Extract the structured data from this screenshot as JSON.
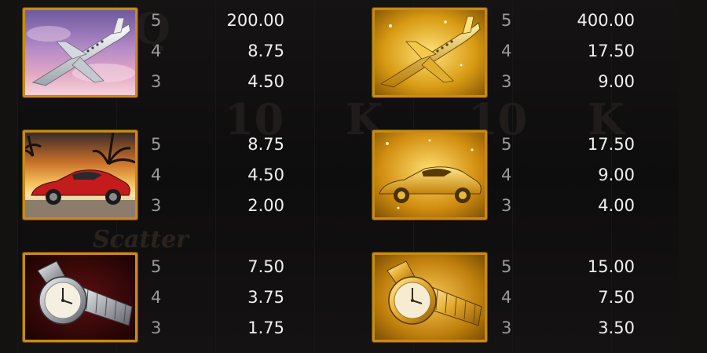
{
  "background": {
    "ghost_symbols": [
      "Q",
      "10",
      "K",
      "10",
      "K",
      "Scatter"
    ]
  },
  "paytable": [
    {
      "symbol": "silver-private-jet",
      "payouts": [
        {
          "count": "5",
          "amount": "200.00"
        },
        {
          "count": "4",
          "amount": "8.75"
        },
        {
          "count": "3",
          "amount": "4.50"
        }
      ]
    },
    {
      "symbol": "gold-private-jet",
      "payouts": [
        {
          "count": "5",
          "amount": "400.00"
        },
        {
          "count": "4",
          "amount": "17.50"
        },
        {
          "count": "3",
          "amount": "9.00"
        }
      ]
    },
    {
      "symbol": "red-sports-car",
      "payouts": [
        {
          "count": "5",
          "amount": "8.75"
        },
        {
          "count": "4",
          "amount": "4.50"
        },
        {
          "count": "3",
          "amount": "2.00"
        }
      ]
    },
    {
      "symbol": "gold-sports-car",
      "payouts": [
        {
          "count": "5",
          "amount": "17.50"
        },
        {
          "count": "4",
          "amount": "9.00"
        },
        {
          "count": "3",
          "amount": "4.00"
        }
      ]
    },
    {
      "symbol": "silver-watch",
      "payouts": [
        {
          "count": "5",
          "amount": "7.50"
        },
        {
          "count": "4",
          "amount": "3.75"
        },
        {
          "count": "3",
          "amount": "1.75"
        }
      ]
    },
    {
      "symbol": "gold-watch",
      "payouts": [
        {
          "count": "5",
          "amount": "15.00"
        },
        {
          "count": "4",
          "amount": "7.50"
        },
        {
          "count": "3",
          "amount": "3.50"
        }
      ]
    }
  ],
  "colors": {
    "frame_gold": "#c88a17",
    "count_text": "#9b9b9b",
    "amount_text": "#f1f1f1",
    "background": "#0b0a0a"
  }
}
